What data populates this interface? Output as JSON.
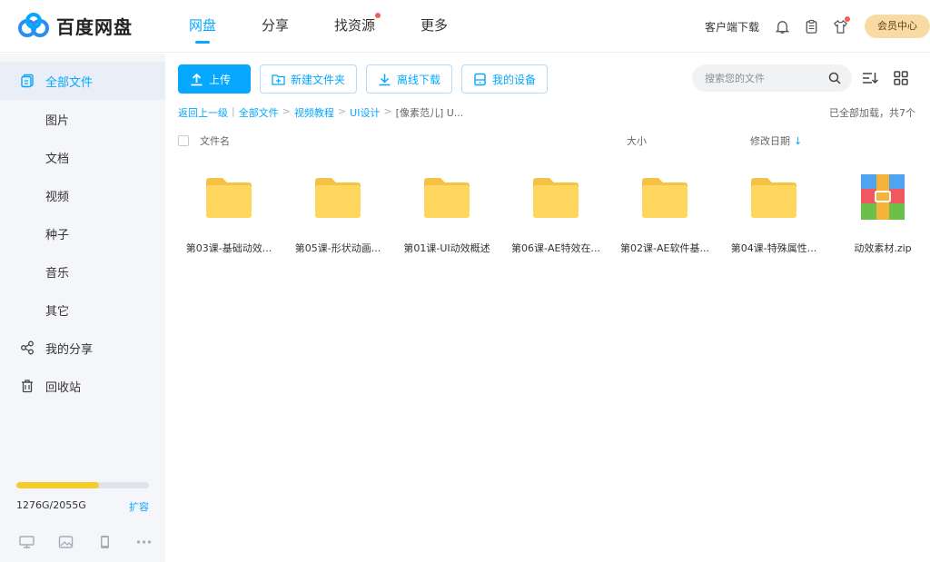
{
  "app": {
    "title": "百度网盘"
  },
  "nav": [
    {
      "label": "网盘",
      "active": true,
      "dot": false
    },
    {
      "label": "分享",
      "active": false,
      "dot": false
    },
    {
      "label": "找资源",
      "active": false,
      "dot": true
    },
    {
      "label": "更多",
      "active": false,
      "dot": false
    }
  ],
  "top_right": {
    "client_download": "客户端下载",
    "icons": [
      "bell-icon",
      "clipboard-icon",
      "tshirt-icon"
    ],
    "vip_label": "会员中心"
  },
  "sidebar": {
    "items": [
      {
        "label": "全部文件",
        "icon": "files-icon",
        "active": true
      },
      {
        "label": "图片",
        "icon": "",
        "active": false
      },
      {
        "label": "文档",
        "icon": "",
        "active": false
      },
      {
        "label": "视频",
        "icon": "",
        "active": false
      },
      {
        "label": "种子",
        "icon": "",
        "active": false
      },
      {
        "label": "音乐",
        "icon": "",
        "active": false
      },
      {
        "label": "其它",
        "icon": "",
        "active": false
      },
      {
        "label": "我的分享",
        "icon": "share-icon",
        "active": false
      },
      {
        "label": "回收站",
        "icon": "trash-icon",
        "active": false
      }
    ],
    "quota": {
      "text": "1276G/2055G",
      "used_fraction": 0.62,
      "expand_label": "扩容"
    },
    "tools": [
      "monitor-icon",
      "image-icon",
      "phone-icon",
      "more-icon"
    ]
  },
  "toolbar": {
    "upload": "上传",
    "new_folder": "新建文件夹",
    "offline_download": "离线下载",
    "my_device": "我的设备"
  },
  "search": {
    "placeholder": "搜索您的文件"
  },
  "breadcrumb": {
    "back": "返回上一级",
    "items": [
      "全部文件",
      "视频教程",
      "UI设计"
    ],
    "current": "[像素范儿] U..."
  },
  "status": {
    "loaded_text": "已全部加载，共7个"
  },
  "columns": {
    "name": "文件名",
    "size": "大小",
    "date": "修改日期"
  },
  "files": [
    {
      "name": "第03课-基础动效...",
      "type": "folder"
    },
    {
      "name": "第05课-形状动画...",
      "type": "folder"
    },
    {
      "name": "第01课-UI动效概述",
      "type": "folder"
    },
    {
      "name": "第06课-AE特效在...",
      "type": "folder"
    },
    {
      "name": "第02课-AE软件基...",
      "type": "folder"
    },
    {
      "name": "第04课-特殊属性...",
      "type": "folder"
    },
    {
      "name": "动效素材.zip",
      "type": "zip"
    }
  ],
  "colors": {
    "accent": "#06a7ff",
    "folder": "#ffd75e",
    "vip": "#f8dba4",
    "quota": "#f6cc2c"
  }
}
